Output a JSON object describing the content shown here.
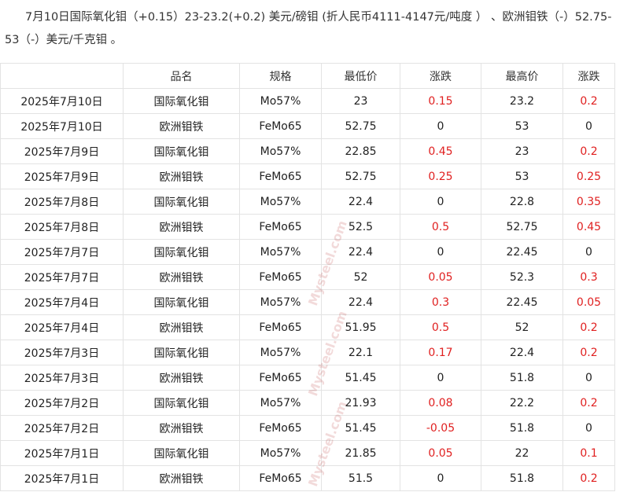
{
  "intro": "7月10日国际氧化钼（+0.15）23-23.2(+0.2) 美元/磅钼 (折人民币4111-4147元/吨度 ） 、欧洲钼铁（-）52.75-53（-）美元/千克钼 。",
  "columns": [
    "",
    "品名",
    "规格",
    "最低价",
    "涨跌",
    "最高价",
    "涨跌"
  ],
  "rows": [
    {
      "date": "2025年7月10日",
      "name": "国际氧化钼",
      "spec": "Mo57%",
      "low": "23",
      "low_change": "0.15",
      "high": "23.2",
      "high_change": "0.2"
    },
    {
      "date": "2025年7月10日",
      "name": "欧洲钼铁",
      "spec": "FeMo65",
      "low": "52.75",
      "low_change": "0",
      "high": "53",
      "high_change": "0"
    },
    {
      "date": "2025年7月9日",
      "name": "国际氧化钼",
      "spec": "Mo57%",
      "low": "22.85",
      "low_change": "0.45",
      "high": "23",
      "high_change": "0.2"
    },
    {
      "date": "2025年7月9日",
      "name": "欧洲钼铁",
      "spec": "FeMo65",
      "low": "52.75",
      "low_change": "0.25",
      "high": "53",
      "high_change": "0.25"
    },
    {
      "date": "2025年7月8日",
      "name": "国际氧化钼",
      "spec": "Mo57%",
      "low": "22.4",
      "low_change": "0",
      "high": "22.8",
      "high_change": "0.35"
    },
    {
      "date": "2025年7月8日",
      "name": "欧洲钼铁",
      "spec": "FeMo65",
      "low": "52.5",
      "low_change": "0.5",
      "high": "52.75",
      "high_change": "0.45"
    },
    {
      "date": "2025年7月7日",
      "name": "国际氧化钼",
      "spec": "Mo57%",
      "low": "22.4",
      "low_change": "0",
      "high": "22.45",
      "high_change": "0"
    },
    {
      "date": "2025年7月7日",
      "name": "欧洲钼铁",
      "spec": "FeMo65",
      "low": "52",
      "low_change": "0.05",
      "high": "52.3",
      "high_change": "0.3"
    },
    {
      "date": "2025年7月4日",
      "name": "国际氧化钼",
      "spec": "Mo57%",
      "low": "22.4",
      "low_change": "0.3",
      "high": "22.45",
      "high_change": "0.05"
    },
    {
      "date": "2025年7月4日",
      "name": "欧洲钼铁",
      "spec": "FeMo65",
      "low": "51.95",
      "low_change": "0.5",
      "high": "52",
      "high_change": "0.2"
    },
    {
      "date": "2025年7月3日",
      "name": "国际氧化钼",
      "spec": "Mo57%",
      "low": "22.1",
      "low_change": "0.17",
      "high": "22.4",
      "high_change": "0.2"
    },
    {
      "date": "2025年7月3日",
      "name": "欧洲钼铁",
      "spec": "FeMo65",
      "low": "51.45",
      "low_change": "0",
      "high": "51.8",
      "high_change": "0"
    },
    {
      "date": "2025年7月2日",
      "name": "国际氧化钼",
      "spec": "Mo57%",
      "low": "21.93",
      "low_change": "0.08",
      "high": "22.2",
      "high_change": "0.2"
    },
    {
      "date": "2025年7月2日",
      "name": "欧洲钼铁",
      "spec": "FeMo65",
      "low": "51.45",
      "low_change": "-0.05",
      "high": "51.8",
      "high_change": "0"
    },
    {
      "date": "2025年7月1日",
      "name": "国际氧化钼",
      "spec": "Mo57%",
      "low": "21.85",
      "low_change": "0.05",
      "high": "22",
      "high_change": "0.1"
    },
    {
      "date": "2025年7月1日",
      "name": "欧洲钼铁",
      "spec": "FeMo65",
      "low": "51.5",
      "low_change": "0",
      "high": "51.8",
      "high_change": "0.2"
    }
  ],
  "watermark_text": "Mysteel.com",
  "colors": {
    "up": "#e02020",
    "neutral": "#222222",
    "border": "#e3e3e3"
  }
}
